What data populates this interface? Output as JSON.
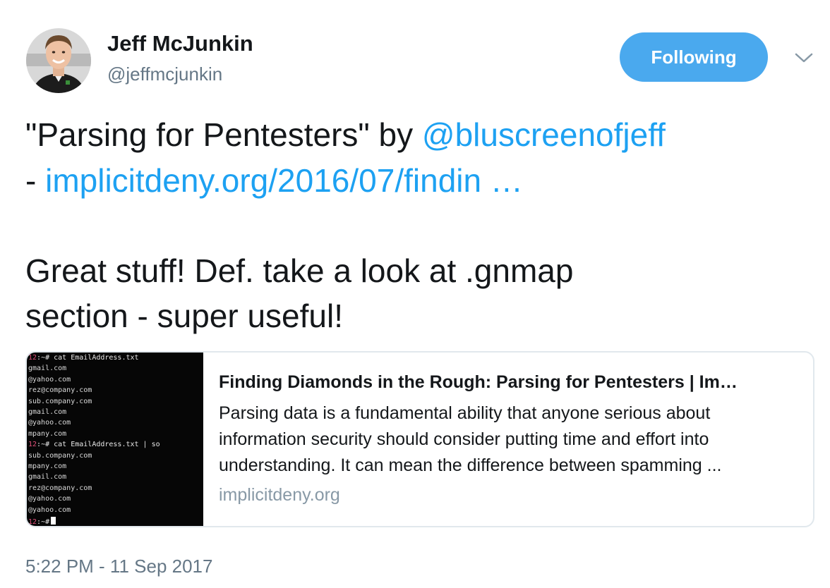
{
  "author": {
    "name": "Jeff McJunkin",
    "handle": "@jeffmcjunkin"
  },
  "follow_button": {
    "label": "Following",
    "color": "#4aa9ee"
  },
  "more_menu": {
    "icon": "chevron-down-icon"
  },
  "tweet": {
    "line1_quote": "\"Parsing for Pentesters\" by ",
    "line1_mention": "@bluscreenofjeff",
    "line2_dash": "- ",
    "line2_link": "implicitdeny.org/2016/07/findin …",
    "line3": "Great stuff! Def. take a look at .gnmap",
    "line4": "section - super useful!",
    "link_color": "#1da1f2"
  },
  "card": {
    "title": "Finding Diamonds in the Rough: Parsing for Pentesters | Im…",
    "description_lines": [
      "Parsing data is a fundamental ability that anyone serious about",
      "information security should consider putting time and effort into",
      "understanding. It can mean the difference between spamming ..."
    ],
    "domain": "implicitdeny.org",
    "terminal": {
      "lines": [
        {
          "prefix": "12",
          "text": ":~# cat EmailAddress.txt"
        },
        {
          "prefix": "",
          "text": "gmail.com"
        },
        {
          "prefix": "",
          "text": "@yahoo.com"
        },
        {
          "prefix": "",
          "text": "rez@company.com"
        },
        {
          "prefix": "",
          "text": "sub.company.com"
        },
        {
          "prefix": "",
          "text": "gmail.com"
        },
        {
          "prefix": "",
          "text": "@yahoo.com"
        },
        {
          "prefix": "",
          "text": "mpany.com"
        },
        {
          "prefix": "12",
          "text": ":~# cat EmailAddress.txt | so"
        },
        {
          "prefix": "",
          "text": "sub.company.com"
        },
        {
          "prefix": "",
          "text": "mpany.com"
        },
        {
          "prefix": "",
          "text": "gmail.com"
        },
        {
          "prefix": "",
          "text": "rez@company.com"
        },
        {
          "prefix": "",
          "text": "@yahoo.com"
        },
        {
          "prefix": "",
          "text": "@yahoo.com"
        },
        {
          "prefix": "12",
          "text": ":~#"
        }
      ]
    }
  },
  "timestamp": "5:22 PM - 11 Sep 2017"
}
